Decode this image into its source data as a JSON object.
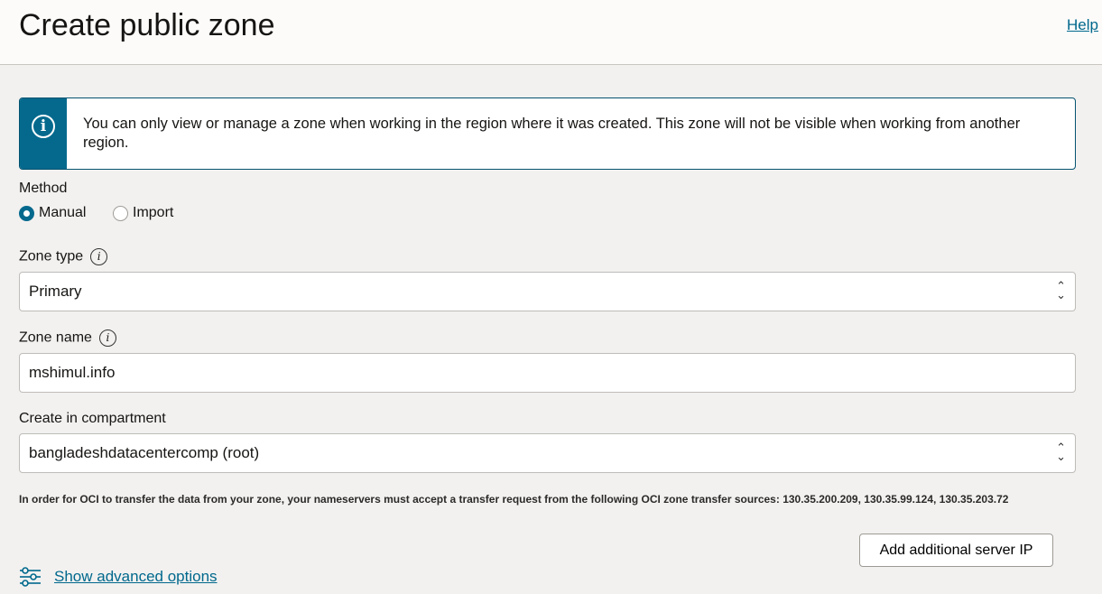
{
  "header": {
    "title": "Create public zone",
    "help": "Help"
  },
  "banner": {
    "message": "You can only view or manage a zone when working in the region where it was created. This zone will not be visible when working from another region.",
    "icon": "info-icon",
    "color": "#04698d"
  },
  "method": {
    "label": "Method",
    "options": [
      {
        "label": "Manual",
        "selected": true
      },
      {
        "label": "Import",
        "selected": false
      }
    ]
  },
  "zone_type": {
    "label": "Zone type",
    "value": "Primary"
  },
  "zone_name": {
    "label": "Zone name",
    "value": "mshimul.info"
  },
  "compartment": {
    "label": "Create in compartment",
    "value": "bangladeshdatacentercomp (root)"
  },
  "note": "In order for OCI to transfer the data from your zone, your nameservers must accept a transfer request from the following OCI zone transfer sources: 130.35.200.209, 130.35.99.124, 130.35.203.72",
  "add_server_button": "Add additional server IP",
  "advanced_link": "Show advanced options"
}
